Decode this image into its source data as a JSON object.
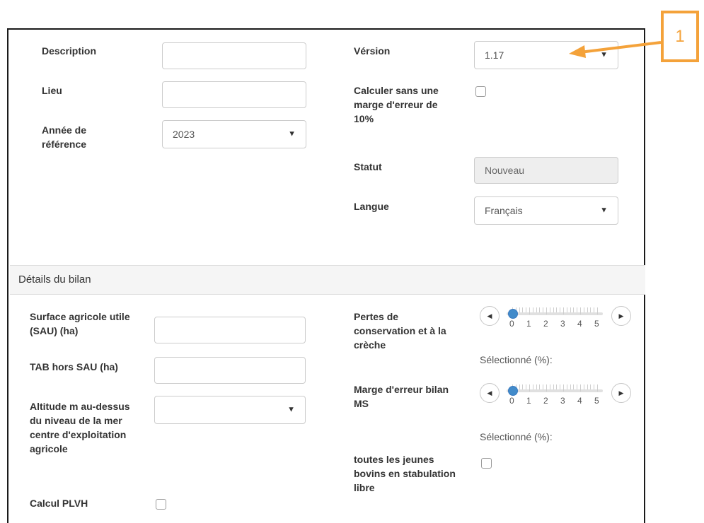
{
  "general": {
    "description_label": "Description",
    "description_value": "",
    "lieu_label": "Lieu",
    "lieu_value": "",
    "annee_label": "Année de référence",
    "annee_value": "2023",
    "version_label": "Vérsion",
    "version_value": "1.17",
    "calculer_label": "Calculer sans une marge d'erreur de 10%",
    "calculer_checked": false,
    "statut_label": "Statut",
    "statut_value": "Nouveau",
    "langue_label": "Langue",
    "langue_value": "Français"
  },
  "details": {
    "section_title": "Détails du bilan",
    "sau_label": "Surface agricole utile (SAU) (ha)",
    "sau_value": "",
    "tab_label": "TAB hors SAU (ha)",
    "tab_value": "",
    "altitude_label": "Altitude m au-dessus du niveau de la mer centre d'exploitation agricole",
    "altitude_value": "",
    "plvh_label": "Calcul PLVH",
    "plvh_checked": false,
    "pertes_label": "Pertes de conservation et à la crèche",
    "pertes_slider": {
      "min": 0,
      "max": 5,
      "value": 0,
      "ticks": [
        "0",
        "1",
        "2",
        "3",
        "4",
        "5"
      ]
    },
    "pertes_selected": "Sélectionné (%):",
    "marge_label": "Marge d'erreur bilan MS",
    "marge_slider": {
      "min": 0,
      "max": 5,
      "value": 0,
      "ticks": [
        "0",
        "1",
        "2",
        "3",
        "4",
        "5"
      ]
    },
    "marge_selected": "Sélectionné (%):",
    "jeunes_label": "toutes les jeunes bovins en stabulation libre",
    "jeunes_checked": false
  },
  "annotation": {
    "badge_text": "1",
    "color": "#f4a23a"
  },
  "icons": [
    "dropdown-caret-icon",
    "chevron-left-icon",
    "chevron-right-icon",
    "slider-handle-icon",
    "arrow-icon"
  ]
}
